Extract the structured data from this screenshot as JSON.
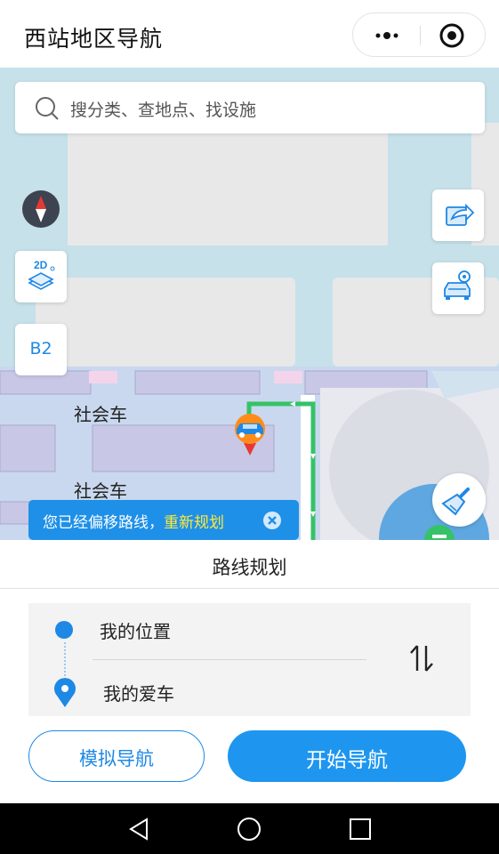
{
  "app": {
    "title": "西站地区导航"
  },
  "capsule": {
    "more_icon": "more-dots-icon",
    "close_icon": "target-close-icon"
  },
  "map": {
    "search_placeholder": "搜分类、查地点、找设施",
    "controls": {
      "view_mode": "2D",
      "floor": "B2"
    },
    "labels": [
      "社会车",
      "社会车"
    ],
    "colors": {
      "route": "#2ecc71",
      "water": "#c6e1e9",
      "block": "#e8e8e8",
      "parking": "#c8d4ec"
    }
  },
  "tip": {
    "message": "您已经偏移路线，",
    "action": "重新规划"
  },
  "route": {
    "header": "路线规划",
    "from": "我的位置",
    "to": "我的爱车",
    "swap_icon": "swap-arrows-icon"
  },
  "actions": {
    "simulate": "模拟导航",
    "start": "开始导航"
  },
  "accent": "#1e88e5"
}
